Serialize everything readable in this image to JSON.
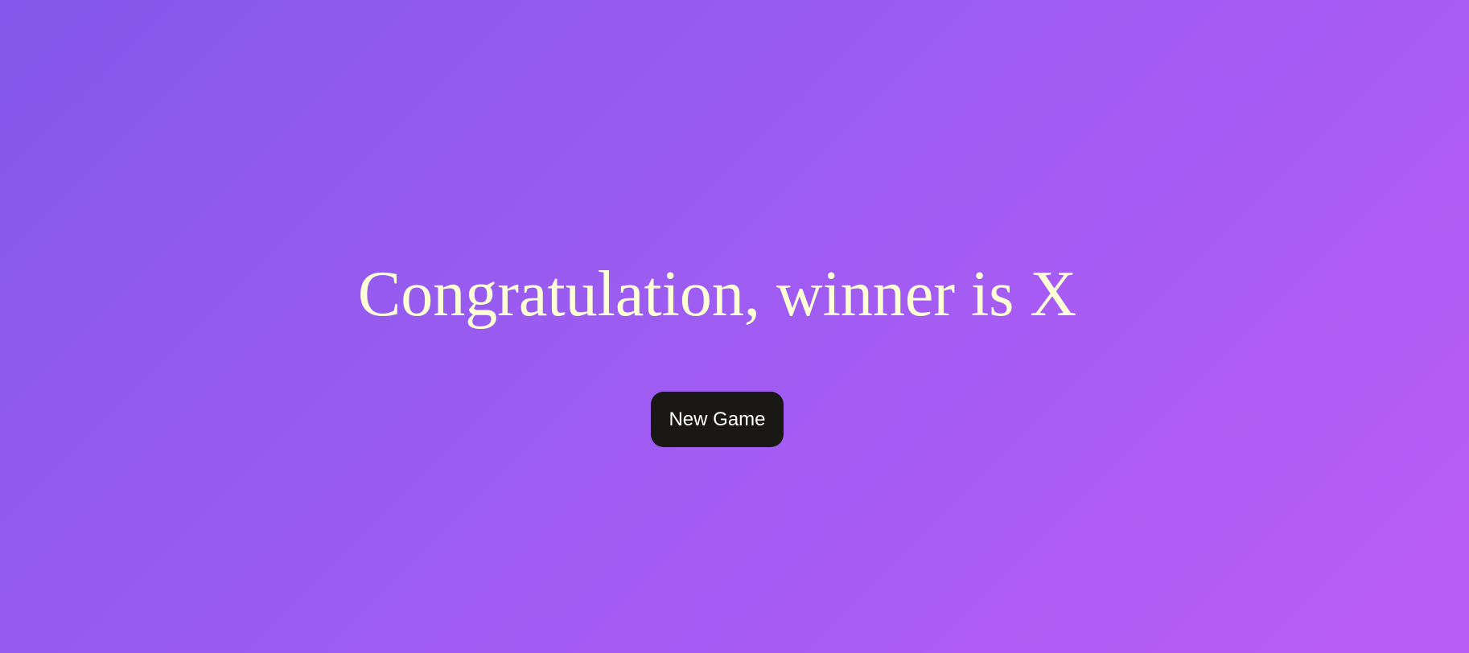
{
  "game": {
    "message": "Congratulation, winner is X",
    "new_game_label": "New Game"
  },
  "colors": {
    "background_start": "#8458ea",
    "background_end": "#bb5cf8",
    "message_text": "#ffffd6",
    "button_background": "#191814",
    "button_text": "#ffffff"
  }
}
